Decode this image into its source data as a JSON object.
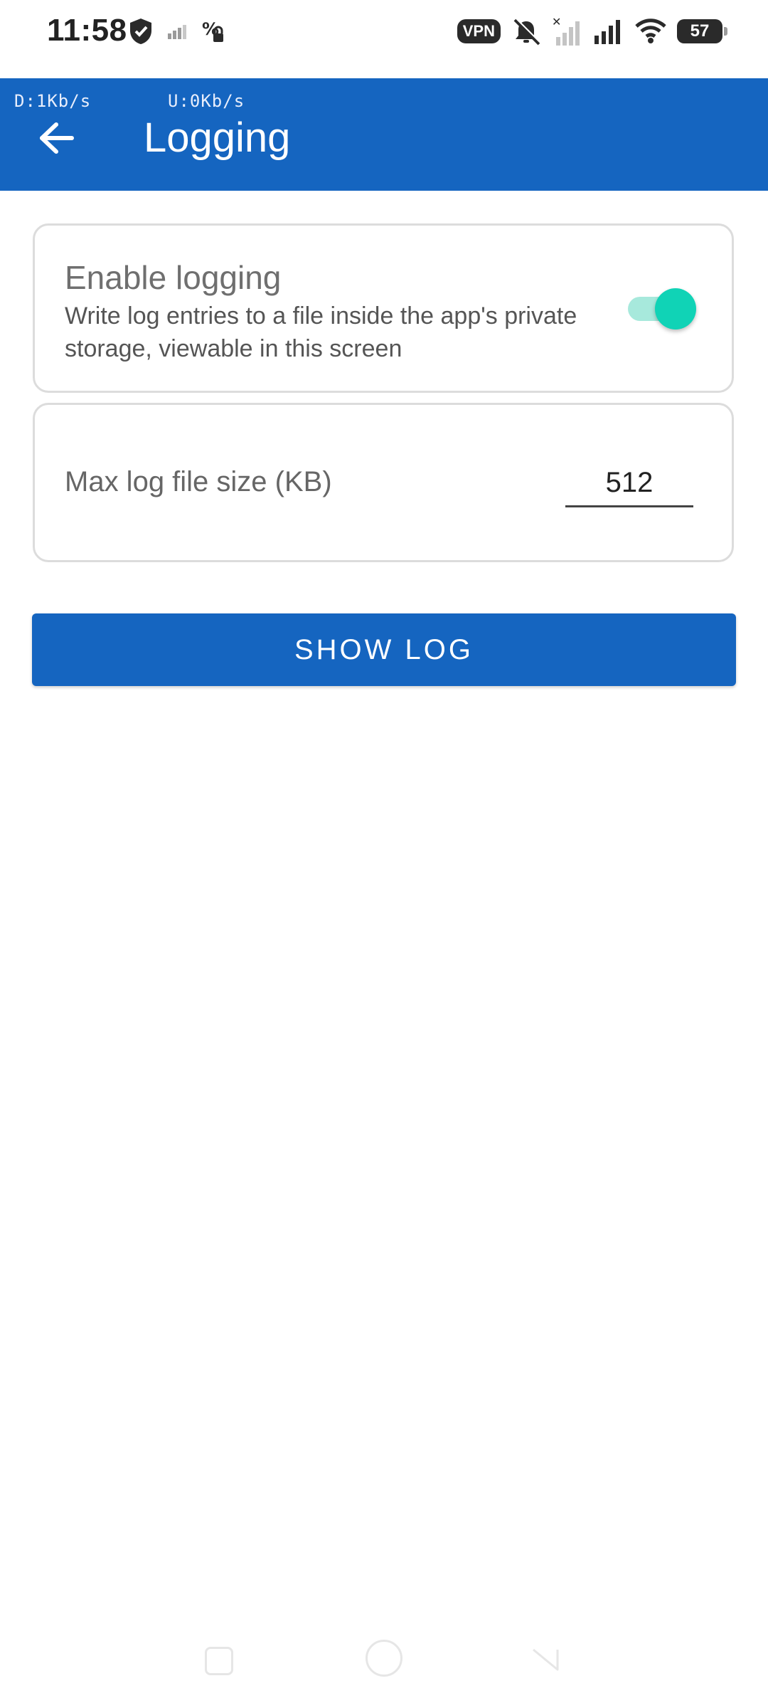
{
  "status_bar": {
    "time": "11:58",
    "left_icons": [
      "shield-icon",
      "signal-weak-icon",
      "data-saver-icon"
    ],
    "right_icons": [
      "vpn-badge",
      "vibrate-off-icon",
      "signal-no-service-icon",
      "signal-icon",
      "wifi-icon",
      "battery-icon"
    ],
    "vpn_label": "VPN",
    "battery_level": "57"
  },
  "app_bar": {
    "download_speed": "D:1Kb/s",
    "upload_speed": "U:0Kb/s",
    "back_icon": "arrow-left-icon",
    "title": "Logging",
    "color": "#1565c0"
  },
  "logging_card": {
    "title": "Enable logging",
    "description": "Write log entries to a file inside the app's private storage, viewable in this screen",
    "enabled": true,
    "toggle_color": "#10d3b6"
  },
  "size_card": {
    "label": "Max log file size (KB)",
    "value": "512"
  },
  "show_log_button": {
    "label": "SHOW LOG"
  },
  "nav_bar": {
    "items": [
      "recents-button",
      "home-button",
      "back-button"
    ]
  }
}
